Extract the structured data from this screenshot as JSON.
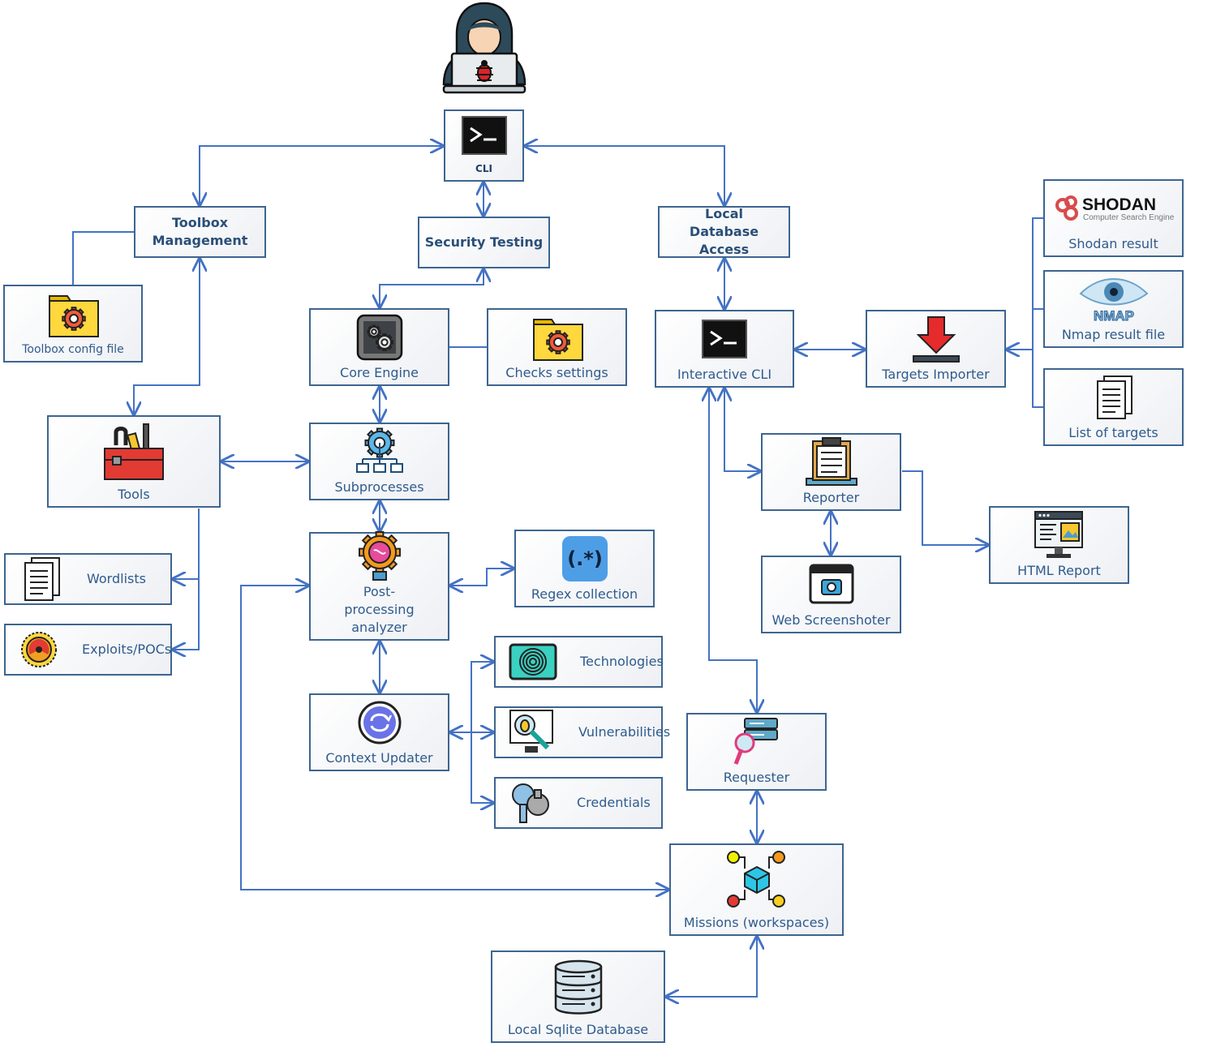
{
  "diagram": {
    "colors": {
      "edge": "#4472c4",
      "node_border": "#3d6590",
      "label": "#2f5b8c"
    },
    "hacker_icon": "hacker-with-bug-laptop-icon",
    "nodes": {
      "cli": {
        "label": "CLI",
        "icon": "terminal-icon"
      },
      "toolbox": {
        "label": "Toolbox Management"
      },
      "security": {
        "label": "Security Testing"
      },
      "localdb": {
        "label": "Local Database Access"
      },
      "toolboxcfg": {
        "label": "Toolbox config file",
        "icon": "folder-gear-icon"
      },
      "core": {
        "label": "Core Engine",
        "icon": "gears-icon"
      },
      "checks": {
        "label": "Checks settings",
        "icon": "folder-gear-icon"
      },
      "icli": {
        "label": "Interactive CLI",
        "icon": "terminal-icon"
      },
      "importer": {
        "label": "Targets Importer",
        "icon": "download-arrow-icon"
      },
      "shodan": {
        "label": "Shodan result",
        "icon": "shodan-logo-icon",
        "logo_text": "SHODAN",
        "logo_subtext": "Computer Search Engine"
      },
      "nmap": {
        "label": "Nmap result file",
        "icon": "nmap-eye-icon",
        "logo_text": "NMAP"
      },
      "listtargets": {
        "label": "List of targets",
        "icon": "documents-icon"
      },
      "tools": {
        "label": "Tools",
        "icon": "toolbox-icon"
      },
      "subproc": {
        "label": "Subprocesses",
        "icon": "gear-network-icon"
      },
      "reporter": {
        "label": "Reporter",
        "icon": "clipboard-icon"
      },
      "html": {
        "label": "HTML Report",
        "icon": "browser-window-icon"
      },
      "wordlists": {
        "label": "Wordlists",
        "icon": "documents-icon"
      },
      "exploits": {
        "label": "Exploits/POCs",
        "icon": "radiation-icon"
      },
      "postproc": {
        "label": "Post-processing analyzer",
        "icon": "brain-gear-icon"
      },
      "regex": {
        "label": "Regex collection",
        "icon": "regex-icon"
      },
      "webshot": {
        "label": "Web Screenshoter",
        "icon": "camera-window-icon"
      },
      "tech": {
        "label": "Technologies",
        "icon": "fingerprint-icon"
      },
      "vulns": {
        "label": "Vulnerabilities",
        "icon": "bug-magnifier-icon"
      },
      "creds": {
        "label": "Credentials",
        "icon": "keys-icon"
      },
      "context": {
        "label": "Context Updater",
        "icon": "sync-icon"
      },
      "requester": {
        "label": "Requester",
        "icon": "server-search-icon"
      },
      "missions": {
        "label": "Missions (workspaces)",
        "icon": "cube-network-icon"
      },
      "sqlite": {
        "label": "Local Sqlite Database",
        "icon": "database-icon"
      }
    }
  }
}
